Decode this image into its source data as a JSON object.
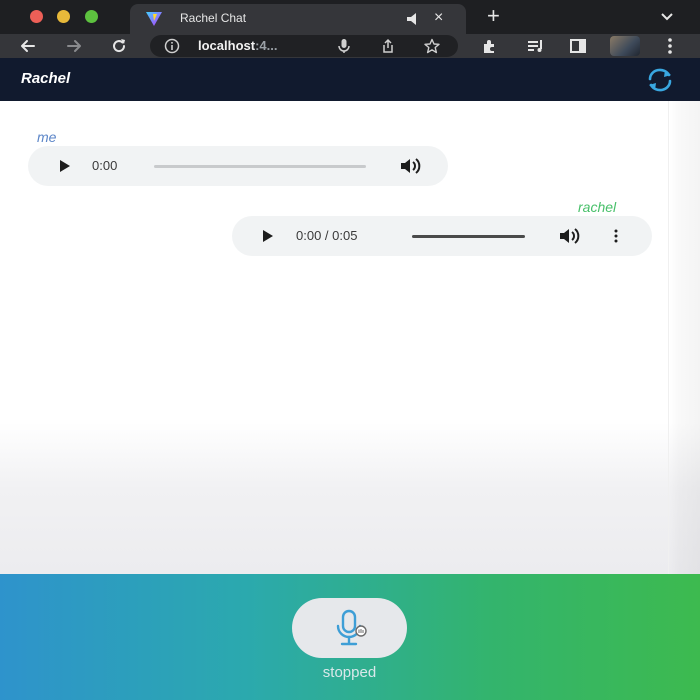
{
  "browser": {
    "tab": {
      "title": "Rachel Chat",
      "close_glyph": "×",
      "favicon_icon": "vite-logo-icon",
      "audio_icon": "speaker-icon"
    },
    "new_tab_glyph": "+",
    "omnibox": {
      "host": "localhost",
      "port_fragment": ":4..."
    },
    "icons": [
      "back-arrow-icon",
      "forward-arrow-icon",
      "reload-icon",
      "info-icon",
      "microphone-icon",
      "share-icon",
      "star-icon",
      "extensions-icon",
      "media-controls-icon",
      "side-panel-icon",
      "profile-avatar",
      "kebab-menu-icon"
    ]
  },
  "app": {
    "title": "Rachel",
    "refresh_icon": "refresh-icon"
  },
  "messages": [
    {
      "sender": "me",
      "time": "0:00"
    },
    {
      "sender": "rachel",
      "time": "0:00 / 0:05"
    }
  ],
  "recorder": {
    "mic_icon": "microphone-icon",
    "status": "stopped"
  },
  "colors": {
    "header_bg": "#111a2e",
    "me_label": "#5c86c8",
    "rachel_label": "#48c06a",
    "recorder_gradient_start": "#2e93cc",
    "recorder_gradient_end": "#3dba4f"
  }
}
